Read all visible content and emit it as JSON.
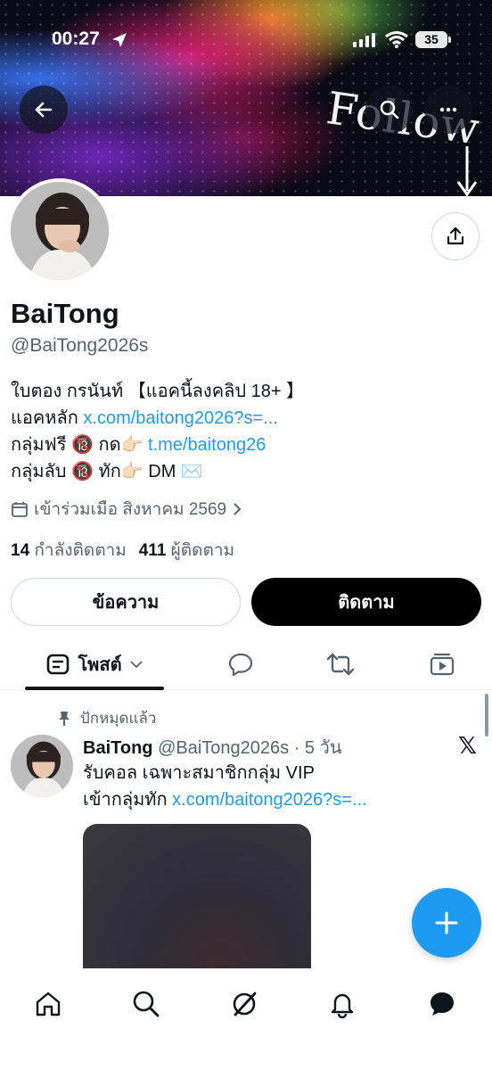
{
  "status_bar": {
    "time": "00:27",
    "battery": "35"
  },
  "banner": {
    "text": "Follow"
  },
  "profile": {
    "name": "BaiTong",
    "handle": "@BaiTong2026s",
    "bio": {
      "line1": "ใบตอง กรนันท์ 【แอคนี้ลงคลิป 18+ 】",
      "line2_prefix": "แอคหลัก ",
      "line2_link": "x.com/baitong2026?s=...",
      "line3_prefix": "กลุ่มฟรี 🔞 กด👉🏻 ",
      "line3_link": "t.me/baitong26",
      "line4": "กลุ่มลับ 🔞 ทัก👉🏻 DM ✉️"
    },
    "joined": "เข้าร่วมเมือ สิงหาคม 2569",
    "following_count": "14",
    "following_label": "กำลังติดตาม",
    "followers_count": "411",
    "followers_label": "ผู้ติดตาม"
  },
  "actions": {
    "message_label": "ข้อความ",
    "follow_label": "ติดตาม"
  },
  "tabs": {
    "posts_label": "โพสต์"
  },
  "post": {
    "pinned_label": "ปักหมุดแล้ว",
    "author_name": "BaiTong",
    "author_meta": "@BaiTong2026s · 5 วัน",
    "text_line1": "รับคอล เฉพาะสมาชิกกลุ่ม VIP",
    "text_line2_prefix": "เข้ากลุ่มทัก ",
    "text_line2_link": "x.com/baitong2026?s=..."
  },
  "colors": {
    "accent": "#1d9bf0",
    "text": "#0f1419",
    "secondary": "#536471"
  },
  "icons": {
    "back": "arrow-left-icon",
    "search": "search-icon",
    "more": "more-icon",
    "share": "share-icon",
    "calendar": "calendar-icon",
    "pin": "pin-icon",
    "compose": "plus-icon",
    "nav": [
      "home-icon",
      "search-icon",
      "grok-icon",
      "bell-icon",
      "messages-icon"
    ]
  }
}
